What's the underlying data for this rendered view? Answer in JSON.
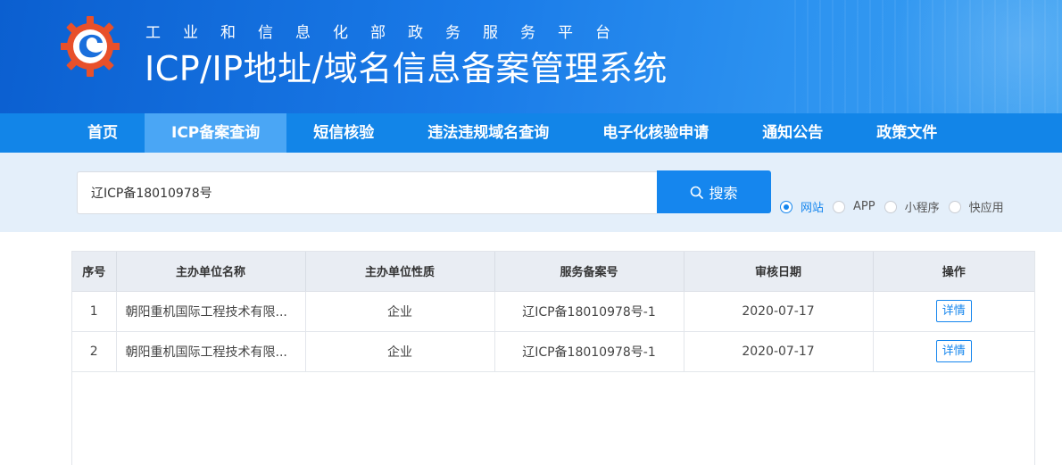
{
  "header": {
    "subtitle": "工业和信息化部政务服务平台",
    "title": "ICP/IP地址/域名信息备案管理系统",
    "logo": "miit-gear-logo-icon"
  },
  "nav": {
    "items": [
      {
        "label": "首页"
      },
      {
        "label": "ICP备案查询",
        "active": true
      },
      {
        "label": "短信核验"
      },
      {
        "label": "违法违规域名查询"
      },
      {
        "label": "电子化核验申请"
      },
      {
        "label": "通知公告"
      },
      {
        "label": "政策文件"
      }
    ]
  },
  "search": {
    "value": "辽ICP备18010978号",
    "button_label": "搜索",
    "button_icon": "search-icon",
    "options": [
      {
        "label": "网站",
        "checked": true
      },
      {
        "label": "APP",
        "checked": false
      },
      {
        "label": "小程序",
        "checked": false
      },
      {
        "label": "快应用",
        "checked": false
      }
    ]
  },
  "table": {
    "headers": [
      "序号",
      "主办单位名称",
      "主办单位性质",
      "服务备案号",
      "审核日期",
      "操作"
    ],
    "rows": [
      {
        "index": "1",
        "name": "朝阳重机国际工程技术有限...",
        "nature": "企业",
        "record_no": "辽ICP备18010978号-1",
        "date": "2020-07-17",
        "action": "详情"
      },
      {
        "index": "2",
        "name": "朝阳重机国际工程技术有限...",
        "nature": "企业",
        "record_no": "辽ICP备18010978号-1",
        "date": "2020-07-17",
        "action": "详情"
      }
    ]
  },
  "colors": {
    "banner": "#1a7be8",
    "nav": "#1285e8",
    "nav_active": "#4aa6f5",
    "accent": "#1586ee",
    "logo_red": "#e8502a"
  }
}
